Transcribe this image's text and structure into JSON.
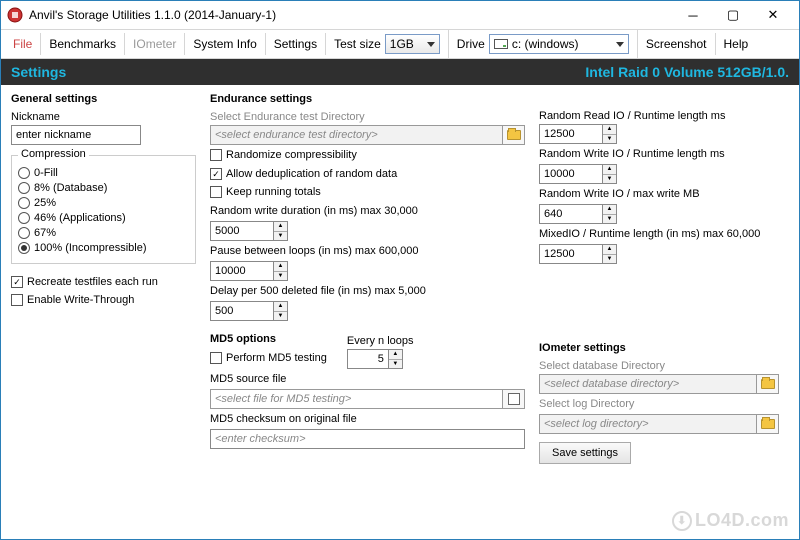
{
  "window": {
    "title": "Anvil's Storage Utilities 1.1.0 (2014-January-1)"
  },
  "toolbar": {
    "file": "File",
    "benchmarks": "Benchmarks",
    "iometer": "IOmeter",
    "system_info": "System Info",
    "settings": "Settings",
    "test_size_label": "Test size",
    "test_size_value": "1GB",
    "drive_label": "Drive",
    "drive_value": "c: (windows)",
    "screenshot": "Screenshot",
    "help": "Help"
  },
  "banner": {
    "left": "Settings",
    "right": "Intel Raid 0 Volume 512GB/1.0."
  },
  "general": {
    "title": "General settings",
    "nickname_label": "Nickname",
    "nickname_value": "enter nickname",
    "compression_legend": "Compression",
    "compression_options": [
      "0-Fill",
      "8% (Database)",
      "25%",
      "46% (Applications)",
      "67%",
      "100% (Incompressible)"
    ],
    "compression_selected_index": 5,
    "recreate_label": "Recreate testfiles each run",
    "recreate_checked": true,
    "write_through_label": "Enable Write-Through",
    "write_through_checked": false
  },
  "endurance": {
    "title": "Endurance settings",
    "dir_label": "Select Endurance test Directory",
    "dir_placeholder": "<select endurance test directory>",
    "randomize_label": "Randomize compressibility",
    "randomize_checked": false,
    "dedup_label": "Allow deduplication of random data",
    "dedup_checked": true,
    "keep_label": "Keep running totals",
    "keep_checked": false,
    "rw_duration_label": "Random write duration (in ms) max 30,000",
    "rw_duration_value": "5000",
    "pause_label": "Pause between loops (in ms) max 600,000",
    "pause_value": "10000",
    "delay_label": "Delay per 500 deleted file (in ms) max 5,000",
    "delay_value": "500"
  },
  "md5": {
    "title": "MD5 options",
    "perform_label": "Perform MD5 testing",
    "perform_checked": false,
    "every_label": "Every n loops",
    "every_value": "5",
    "source_label": "MD5 source file",
    "source_placeholder": "<select file for MD5 testing>",
    "checksum_label": "MD5 checksum on original file",
    "checksum_placeholder": "<enter checksum>"
  },
  "runtime": {
    "read_label": "Random Read IO / Runtime length ms",
    "read_value": "12500",
    "write_label": "Random Write IO / Runtime length ms",
    "write_value": "10000",
    "maxwrite_label": "Random Write IO / max write MB",
    "maxwrite_value": "640",
    "mixed_label": "MixedIO / Runtime length (in ms) max 60,000",
    "mixed_value": "12500"
  },
  "iometer": {
    "title": "IOmeter settings",
    "db_label": "Select database Directory",
    "db_placeholder": "<select database directory>",
    "log_label": "Select log Directory",
    "log_placeholder": "<select log directory>"
  },
  "save_label": "Save settings",
  "watermark": "LO4D.com"
}
